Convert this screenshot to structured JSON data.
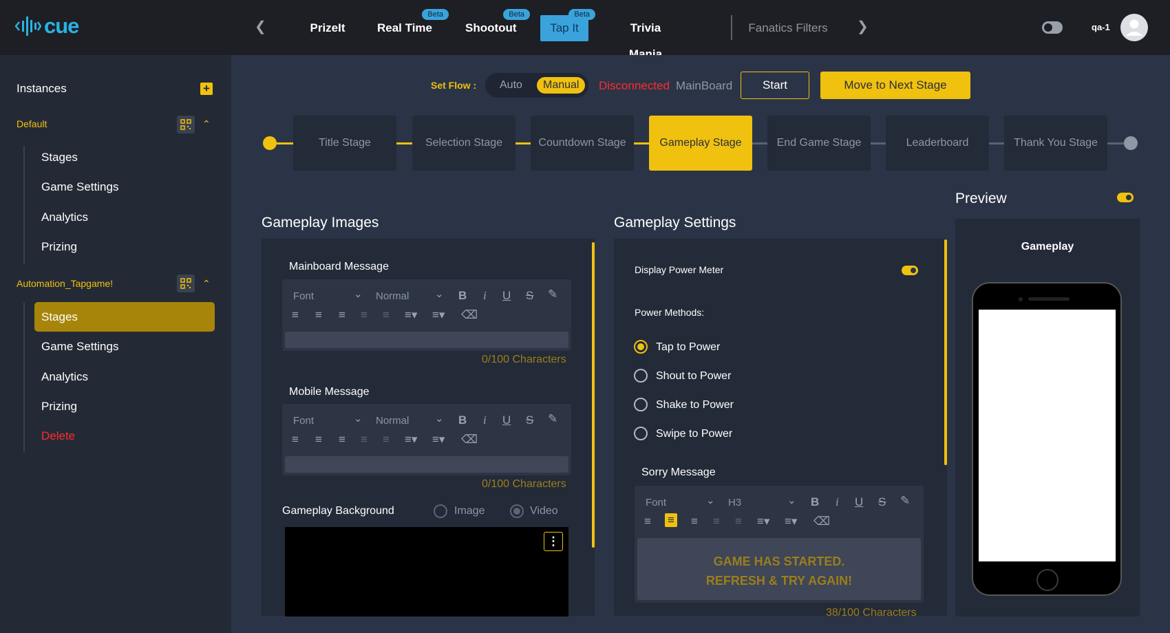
{
  "header": {
    "logo": "cue",
    "tabs": [
      {
        "label": "PrizeIt",
        "beta": ""
      },
      {
        "label": "Real Time",
        "beta": "Beta"
      },
      {
        "label": "Shootout",
        "beta": "Beta"
      },
      {
        "label": "Tap It",
        "beta": "Beta"
      },
      {
        "label": "Trivia Mania",
        "beta": ""
      }
    ],
    "filters_label": "Fanatics Filters",
    "user": "qa-1"
  },
  "sidebar": {
    "instances_label": "Instances",
    "group1": {
      "name": "Default",
      "items": [
        "Stages",
        "Game Settings",
        "Analytics",
        "Prizing"
      ]
    },
    "group2": {
      "name": "Automation_Tapgame!",
      "items": [
        "Stages",
        "Game Settings",
        "Analytics",
        "Prizing",
        "Delete"
      ]
    }
  },
  "flow": {
    "label": "Set Flow :",
    "auto": "Auto",
    "manual": "Manual",
    "status": "Disconnected",
    "board": "MainBoard",
    "start": "Start",
    "next": "Move to Next Stage"
  },
  "stages": [
    "Title Stage",
    "Selection Stage",
    "Countdown Stage",
    "Gameplay Stage",
    "End Game Stage",
    "Leaderboard",
    "Thank You Stage"
  ],
  "images_section": {
    "title": "Gameplay Images",
    "mainboard_label": "Mainboard Message",
    "mobile_label": "Mobile Message",
    "font": "Font",
    "size": "Normal",
    "count1": "0/100 Characters",
    "count2": "0/100 Characters",
    "bg_label": "Gameplay Background",
    "image_opt": "Image",
    "video_opt": "Video"
  },
  "settings_section": {
    "title": "Gameplay Settings",
    "power_meter": "Display Power Meter",
    "methods_label": "Power Methods:",
    "methods": [
      "Tap to Power",
      "Shout to Power",
      "Shake to Power",
      "Swipe to Power"
    ],
    "sorry_label": "Sorry Message",
    "font": "Font",
    "heading": "H3",
    "sorry_text_line1": "GAME HAS STARTED.",
    "sorry_text_line2": "REFRESH & TRY AGAIN!",
    "count": "38/100 Characters"
  },
  "preview": {
    "title": "Preview",
    "screen_label": "Gameplay"
  },
  "colors": {
    "accent": "#f0c10f",
    "brand": "#27b3e5",
    "danger": "#ff2b2b"
  }
}
